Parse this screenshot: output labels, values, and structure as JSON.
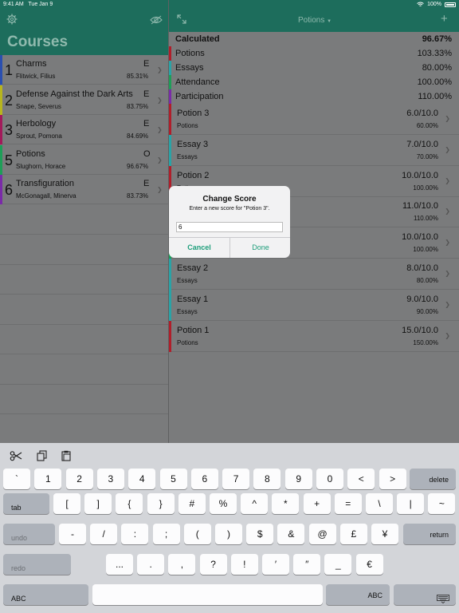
{
  "status_bar": {
    "time": "9:41 AM",
    "date": "Tue Jan 9",
    "battery": "100%"
  },
  "left": {
    "title": "Courses",
    "courses": [
      {
        "num": "1",
        "name": "Charms",
        "grade": "E",
        "teacher": "Flitwick, Filius",
        "pct": "85.31%",
        "color": "#2a4fb0"
      },
      {
        "num": "2",
        "name": "Defense Against the Dark Arts",
        "grade": "E",
        "teacher": "Snape, Severus",
        "pct": "83.75%",
        "color": "#b7b51e"
      },
      {
        "num": "3",
        "name": "Herbology",
        "grade": "E",
        "teacher": "Sprout, Pomona",
        "pct": "84.69%",
        "color": "#a21a5a"
      },
      {
        "num": "5",
        "name": "Potions",
        "grade": "O",
        "teacher": "Slughorn, Horace",
        "pct": "96.67%",
        "color": "#1e9e58"
      },
      {
        "num": "6",
        "name": "Transfiguration",
        "grade": "E",
        "teacher": "McGonagall, Minerva",
        "pct": "83.73%",
        "color": "#7a2aa8"
      }
    ]
  },
  "right": {
    "title": "Potions",
    "summary": [
      {
        "label": "Calculated",
        "value": "96.67%",
        "bold": true,
        "color": ""
      },
      {
        "label": "Potions",
        "value": "103.33%",
        "bold": false,
        "color": "#b01e2a"
      },
      {
        "label": "Essays",
        "value": "80.00%",
        "bold": false,
        "color": "#2aa3a6"
      },
      {
        "label": "Attendance",
        "value": "100.00%",
        "bold": false,
        "color": "#1e9e58"
      },
      {
        "label": "Participation",
        "value": "110.00%",
        "bold": false,
        "color": "#7a2aa8"
      }
    ],
    "scores": [
      {
        "name": "Potion 3",
        "score": "6.0/10.0",
        "category": "Potions",
        "pct": "60.00%",
        "color": "#b01e2a"
      },
      {
        "name": "Essay 3",
        "score": "7.0/10.0",
        "category": "Essays",
        "pct": "70.00%",
        "color": "#2aa3a6"
      },
      {
        "name": "Potion 2",
        "score": "10.0/10.0",
        "category": "Potions",
        "pct": "100.00%",
        "color": "#b01e2a"
      },
      {
        "name": "",
        "score": "11.0/10.0",
        "category": "",
        "pct": "110.00%",
        "color": "#7a2aa8"
      },
      {
        "name": "",
        "score": "10.0/10.0",
        "category": "",
        "pct": "100.00%",
        "color": "#1e9e58"
      },
      {
        "name": "Essay 2",
        "score": "8.0/10.0",
        "category": "Essays",
        "pct": "80.00%",
        "color": "#2aa3a6"
      },
      {
        "name": "Essay 1",
        "score": "9.0/10.0",
        "category": "Essays",
        "pct": "90.00%",
        "color": "#2aa3a6"
      },
      {
        "name": "Potion 1",
        "score": "15.0/10.0",
        "category": "Potions",
        "pct": "150.00%",
        "color": "#b01e2a"
      }
    ]
  },
  "dialog": {
    "title": "Change Score",
    "message": "Enter a new score for \"Potion 3\".",
    "input_value": "6",
    "cancel": "Cancel",
    "done": "Done"
  },
  "keyboard": {
    "row1": [
      "`",
      "1",
      "2",
      "3",
      "4",
      "5",
      "6",
      "7",
      "8",
      "9",
      "0",
      "<",
      ">"
    ],
    "delete": "delete",
    "tab": "tab",
    "row2": [
      "[",
      "]",
      "{",
      "}",
      "#",
      "%",
      "^",
      "*",
      "+",
      "=",
      "\\",
      "|",
      "~"
    ],
    "undo": "undo",
    "row3": [
      "-",
      "/",
      ":",
      ";",
      "(",
      ")",
      "$",
      "&",
      "@",
      "£",
      "¥"
    ],
    "return": "return",
    "redo": "redo",
    "row4": [
      "...",
      ".",
      ",",
      "?",
      "!",
      "′",
      "″",
      "_",
      "€"
    ],
    "abc_left": "ABC",
    "abc_right": "ABC"
  },
  "colors": {
    "accent": "#1d9e7a",
    "header": "#1d6d5c"
  }
}
